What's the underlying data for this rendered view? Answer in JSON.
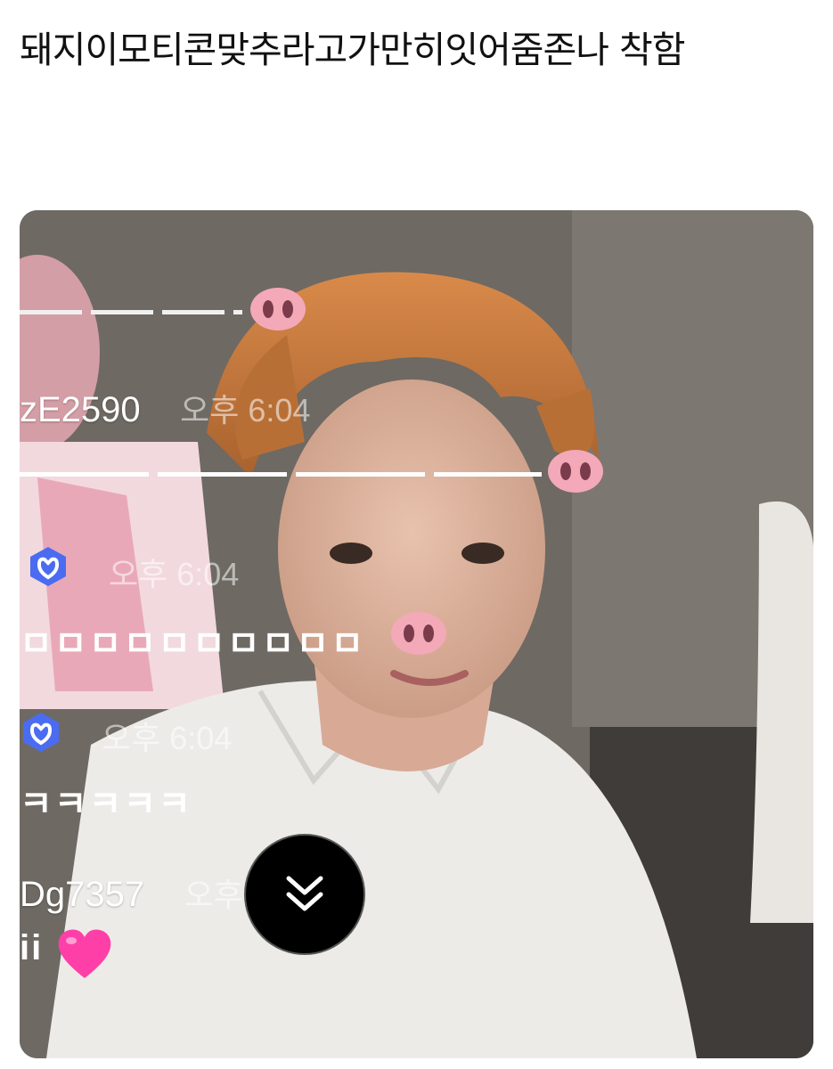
{
  "post": {
    "text": "돼지이모티콘맞추라고가만히잇어줌존나 착함"
  },
  "chat": {
    "line1_dashes": "— — — — — -",
    "user1": "zE2590",
    "user1_time": "오후 6:04",
    "user2_time": "오후 6:04",
    "user2_message": "ㅁㅁㅁㅁㅁㅁㅁㅁㅁㅁ",
    "user3_time": "오후 6:04",
    "user3_message": "ㅋㅋㅋㅋㅋ",
    "user4": "Dg7357",
    "user4_time_partial": "오후",
    "user4_message": "ii"
  },
  "icons": {
    "pig_nose": "pig-nose-emoji",
    "badge": "membership-badge-icon",
    "heart": "pink-heart-emoji",
    "scroll": "double-chevron-down-icon"
  },
  "colors": {
    "pig_pink": "#f3a9b8",
    "badge_blue": "#4b6cf0",
    "heart_pink": "#ff3fa8"
  }
}
